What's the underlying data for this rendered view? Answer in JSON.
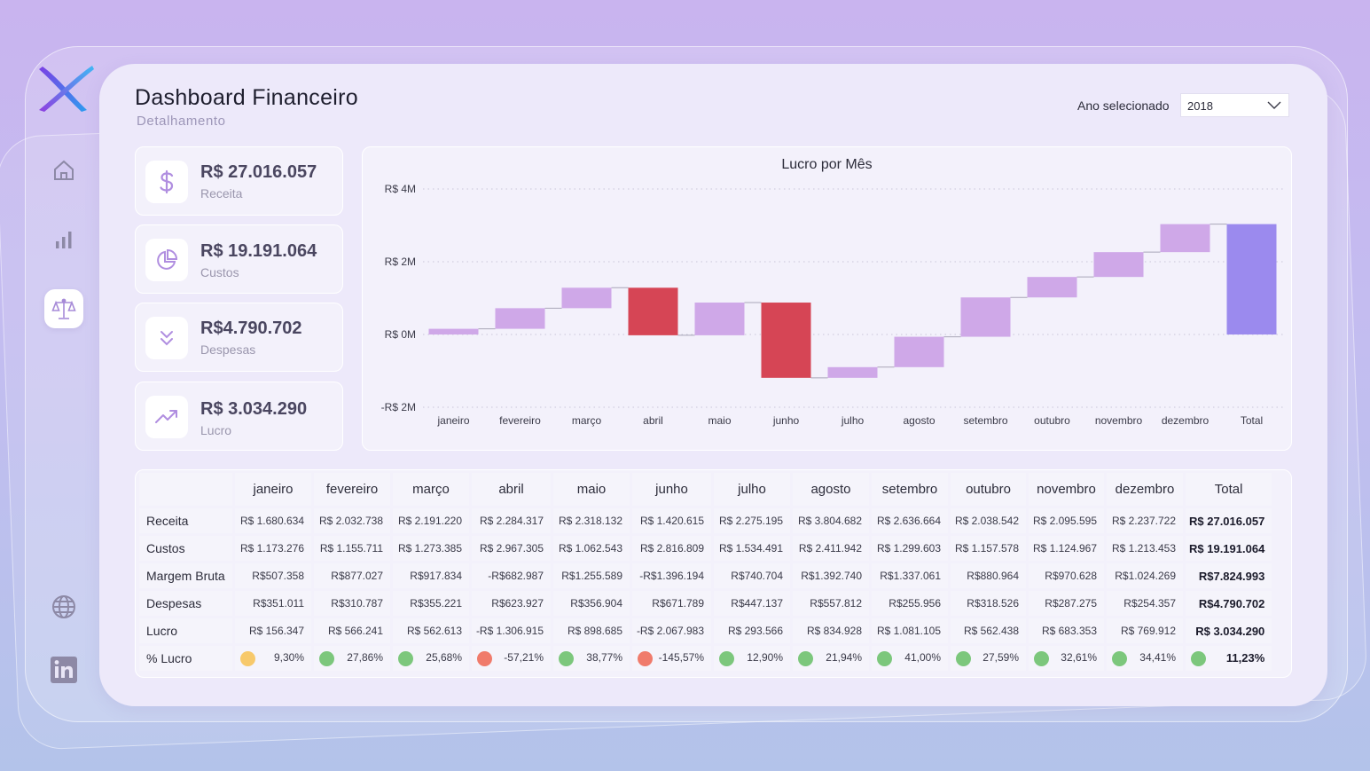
{
  "header": {
    "title": "Dashboard Financeiro",
    "subtitle": "Detalhamento",
    "year_label": "Ano selecionado",
    "year_value": "2018"
  },
  "sidebar": {
    "items": [
      {
        "icon": "home-icon"
      },
      {
        "icon": "bar-chart-icon"
      },
      {
        "icon": "balance-scale-icon",
        "active": true
      },
      {
        "icon": "globe-icon"
      },
      {
        "icon": "linkedin-icon"
      }
    ]
  },
  "kpis": [
    {
      "value": "R$ 27.016.057",
      "label": "Receita",
      "icon": "dollar-icon"
    },
    {
      "value": "R$ 19.191.064",
      "label": "Custos",
      "icon": "pie-chart-icon"
    },
    {
      "value": "R$4.790.702",
      "label": "Despesas",
      "icon": "double-chevron-down-icon"
    },
    {
      "value": "R$ 3.034.290",
      "label": "Lucro",
      "icon": "trending-up-icon"
    }
  ],
  "chart_data": {
    "type": "bar",
    "subtype": "waterfall",
    "title": "Lucro por Mês",
    "categories": [
      "janeiro",
      "fevereiro",
      "março",
      "abril",
      "maio",
      "junho",
      "julho",
      "agosto",
      "setembro",
      "outubro",
      "novembro",
      "dezembro",
      "Total"
    ],
    "values": [
      156347,
      566241,
      562613,
      -1306915,
      898685,
      -2067983,
      293566,
      834928,
      1081105,
      562438,
      683353,
      769912,
      3034290
    ],
    "y_ticks": [
      "R$ 4M",
      "R$ 2M",
      "R$ 0M",
      "-R$ 2M"
    ],
    "ylim": [
      -2000000,
      4000000
    ],
    "colors": {
      "increase": "#cfa8e8",
      "decrease": "#d64555",
      "total": "#9b8aee"
    },
    "grid": true
  },
  "table": {
    "columns": [
      "janeiro",
      "fevereiro",
      "março",
      "abril",
      "maio",
      "junho",
      "julho",
      "agosto",
      "setembro",
      "outubro",
      "novembro",
      "dezembro",
      "Total"
    ],
    "rows": [
      {
        "label": "Receita",
        "values": [
          "R$ 1.680.634",
          "R$ 2.032.738",
          "R$ 2.191.220",
          "R$ 2.284.317",
          "R$ 2.318.132",
          "R$ 1.420.615",
          "R$ 2.275.195",
          "R$ 3.804.682",
          "R$ 2.636.664",
          "R$ 2.038.542",
          "R$ 2.095.595",
          "R$ 2.237.722",
          "R$ 27.016.057"
        ]
      },
      {
        "label": "Custos",
        "values": [
          "R$ 1.173.276",
          "R$ 1.155.711",
          "R$ 1.273.385",
          "R$ 2.967.305",
          "R$ 1.062.543",
          "R$ 2.816.809",
          "R$ 1.534.491",
          "R$ 2.411.942",
          "R$ 1.299.603",
          "R$ 1.157.578",
          "R$ 1.124.967",
          "R$ 1.213.453",
          "R$ 19.191.064"
        ]
      },
      {
        "label": "Margem Bruta",
        "values": [
          "R$507.358",
          "R$877.027",
          "R$917.834",
          "-R$682.987",
          "R$1.255.589",
          "-R$1.396.194",
          "R$740.704",
          "R$1.392.740",
          "R$1.337.061",
          "R$880.964",
          "R$970.628",
          "R$1.024.269",
          "R$7.824.993"
        ]
      },
      {
        "label": "Despesas",
        "values": [
          "R$351.011",
          "R$310.787",
          "R$355.221",
          "R$623.927",
          "R$356.904",
          "R$671.789",
          "R$447.137",
          "R$557.812",
          "R$255.956",
          "R$318.526",
          "R$287.275",
          "R$254.357",
          "R$4.790.702"
        ]
      },
      {
        "label": "Lucro",
        "values": [
          "R$ 156.347",
          "R$ 566.241",
          "R$ 562.613",
          "-R$ 1.306.915",
          "R$ 898.685",
          "-R$ 2.067.983",
          "R$ 293.566",
          "R$ 834.928",
          "R$ 1.081.105",
          "R$ 562.438",
          "R$ 683.353",
          "R$ 769.912",
          "R$ 3.034.290"
        ]
      },
      {
        "label": "% Lucro",
        "values": [
          "9,30%",
          "27,86%",
          "25,68%",
          "-57,21%",
          "38,77%",
          "-145,57%",
          "12,90%",
          "21,94%",
          "41,00%",
          "27,59%",
          "32,61%",
          "34,41%",
          "11,23%"
        ],
        "status": [
          "yellow",
          "green",
          "green",
          "red",
          "green",
          "red",
          "green",
          "green",
          "green",
          "green",
          "green",
          "green",
          "green"
        ]
      }
    ],
    "status_colors": {
      "yellow": "#f7c96b",
      "green": "#7cc77c",
      "red": "#f07b6b"
    }
  }
}
